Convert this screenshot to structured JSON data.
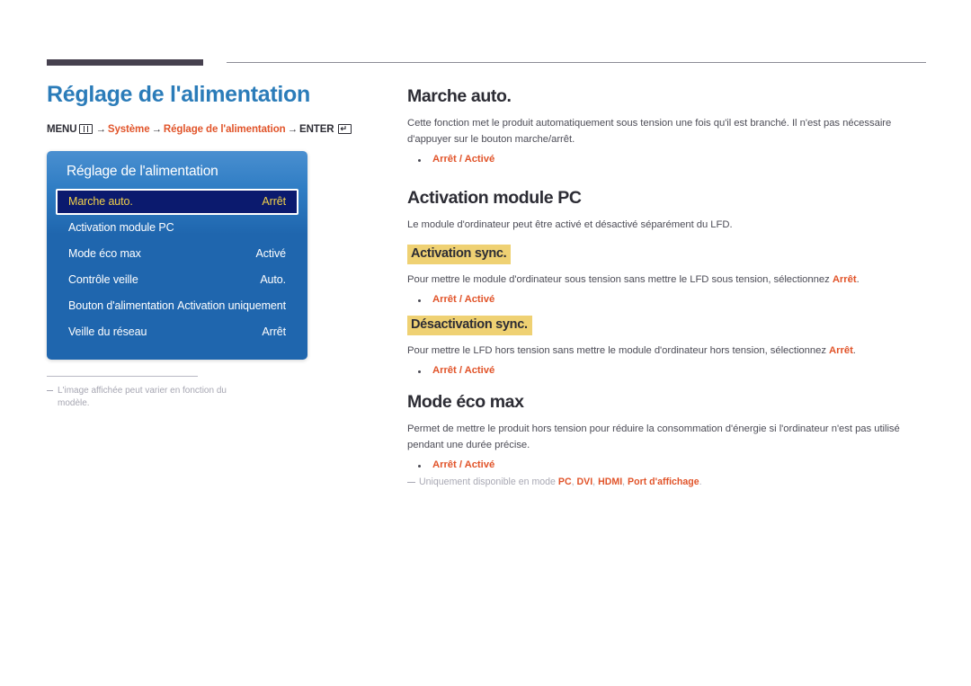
{
  "page": {
    "title": "Réglage de l'alimentation"
  },
  "breadcrumb": {
    "menu_label": "MENU",
    "menu_icon": "menu-bars-icon",
    "arrow": "→",
    "step1": "Système",
    "step2": "Réglage de l'alimentation",
    "enter_label": "ENTER",
    "enter_icon": "enter-key-icon"
  },
  "osd": {
    "title": "Réglage de l'alimentation",
    "rows": [
      {
        "label": "Marche auto.",
        "value": "Arrêt",
        "selected": true
      },
      {
        "label": "Activation module PC",
        "value": "",
        "selected": false
      },
      {
        "label": "Mode éco max",
        "value": "Activé",
        "selected": false
      },
      {
        "label": "Contrôle veille",
        "value": "Auto.",
        "selected": false
      },
      {
        "label": "Bouton d'alimentation",
        "value": "Activation uniquement",
        "selected": false
      },
      {
        "label": "Veille du réseau",
        "value": "Arrêt",
        "selected": false
      }
    ]
  },
  "left_note": {
    "text": "L'image affichée peut varier en fonction du modèle."
  },
  "sections": {
    "marche_auto": {
      "heading": "Marche auto.",
      "paragraph": "Cette fonction met le produit automatiquement sous tension une fois qu'il est branché. Il n'est pas nécessaire d'appuyer sur le bouton marche/arrêt.",
      "option": "Arrêt / Activé"
    },
    "activation_module_pc": {
      "heading": "Activation module PC",
      "paragraph": "Le module d'ordinateur peut être activé et désactivé séparément du LFD.",
      "sub1": {
        "heading": "Activation sync.",
        "text_before": "Pour mettre le module d'ordinateur sous tension sans mettre le LFD sous tension, sélectionnez ",
        "text_accent": "Arrêt",
        "text_after": ".",
        "option": "Arrêt / Activé"
      },
      "sub2": {
        "heading": "Désactivation sync.",
        "text_before": "Pour mettre le LFD hors tension sans mettre le module d'ordinateur hors tension, sélectionnez ",
        "text_accent": "Arrêt",
        "text_after": ".",
        "option": "Arrêt / Activé"
      }
    },
    "mode_eco_max": {
      "heading": "Mode éco max",
      "paragraph": "Permet de mettre le produit hors tension pour réduire la consommation d'énergie si l'ordinateur n'est pas utilisé pendant une durée précise.",
      "option": "Arrêt / Activé",
      "footnote": {
        "text_before": "Uniquement disponible en mode ",
        "m1": "PC",
        "sep1": ", ",
        "m2": "DVI",
        "sep2": ", ",
        "m3": "HDMI",
        "sep3": ", ",
        "m4": "Port d'affichage",
        "text_after": "."
      }
    }
  },
  "colors": {
    "title_blue": "#2b7cb9",
    "accent_orange": "#e1542a",
    "highlight_yellow": "#efd173",
    "osd_blue": "#1f66ae",
    "osd_selected_navy": "#0b1a6e",
    "osd_selected_text": "#f2d14a"
  }
}
